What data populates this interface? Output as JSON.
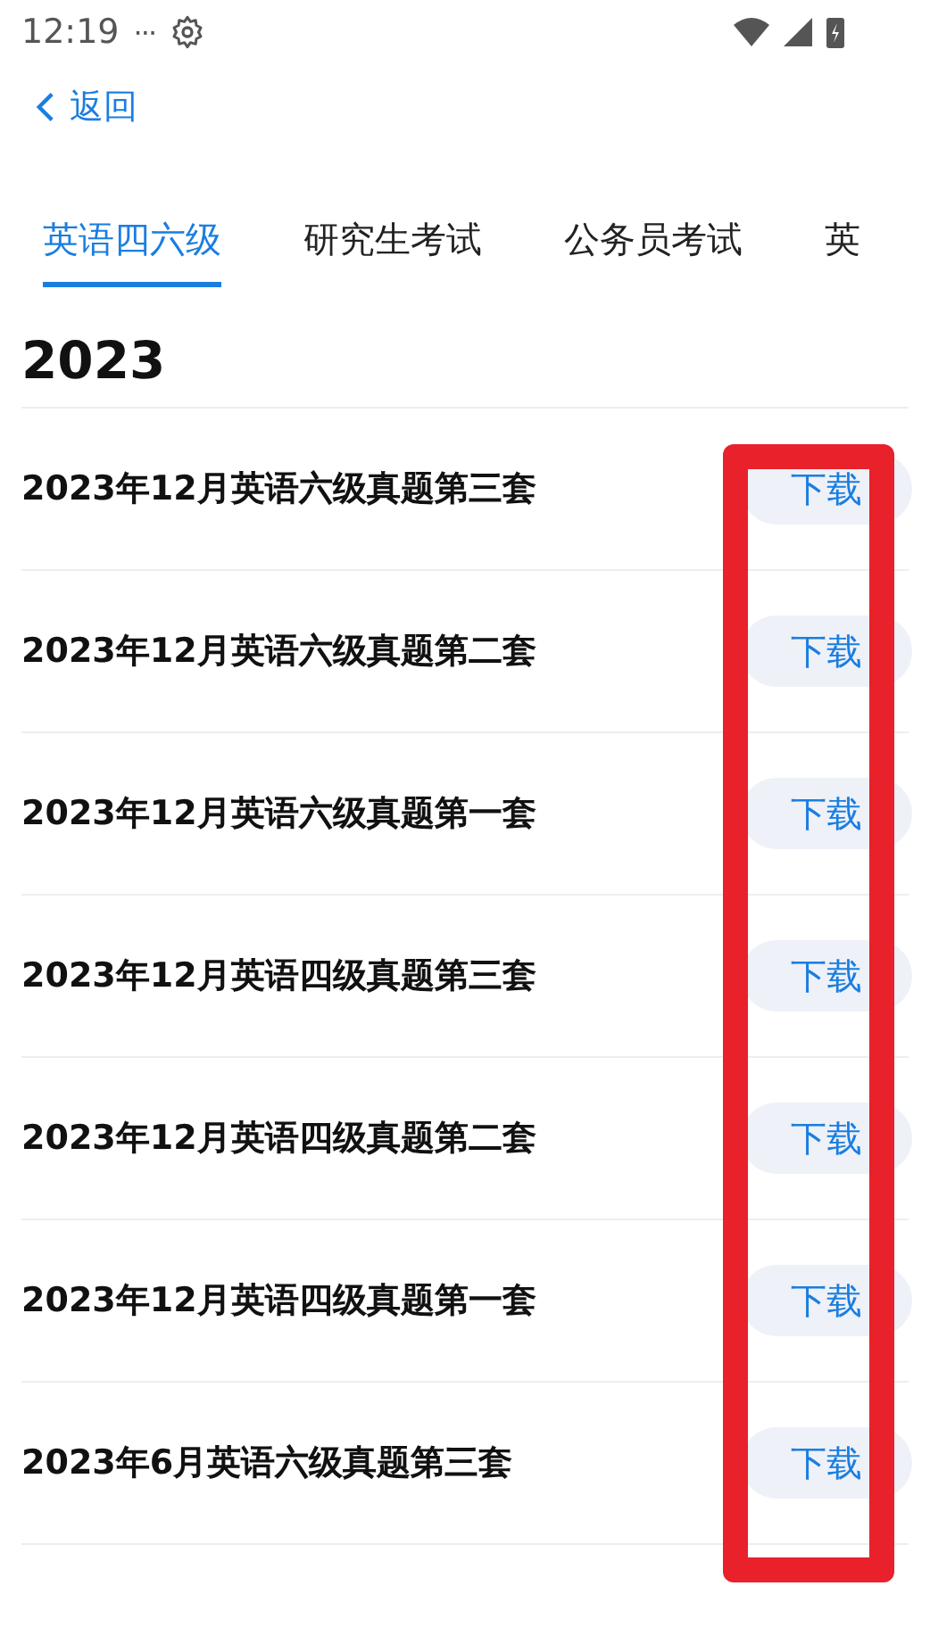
{
  "status_bar": {
    "time": "12:19",
    "more": "···"
  },
  "nav": {
    "back": "返回"
  },
  "tabs": [
    {
      "label": "英语四六级",
      "selected": true
    },
    {
      "label": "研究生考试",
      "selected": false
    },
    {
      "label": "公务员考试",
      "selected": false
    },
    {
      "label": "英",
      "selected": false
    }
  ],
  "section": {
    "year": "2023"
  },
  "items": [
    {
      "title": "2023年12月英语六级真题第三套",
      "action": "下载"
    },
    {
      "title": "2023年12月英语六级真题第二套",
      "action": "下载"
    },
    {
      "title": "2023年12月英语六级真题第一套",
      "action": "下载"
    },
    {
      "title": "2023年12月英语四级真题第三套",
      "action": "下载"
    },
    {
      "title": "2023年12月英语四级真题第二套",
      "action": "下载"
    },
    {
      "title": "2023年12月英语四级真题第一套",
      "action": "下载"
    },
    {
      "title": "2023年6月英语六级真题第三套",
      "action": "下载"
    }
  ]
}
